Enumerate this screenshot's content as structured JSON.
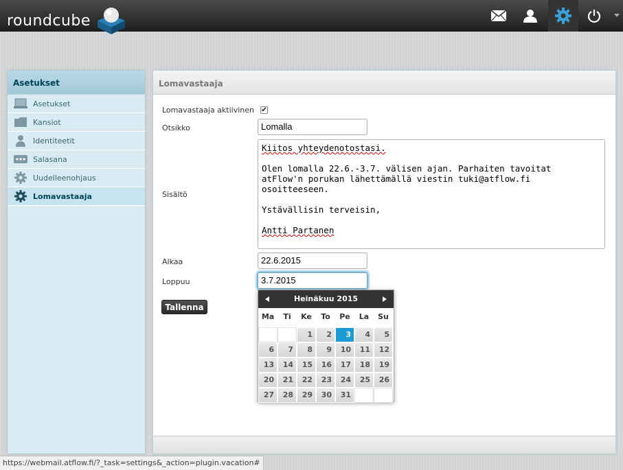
{
  "app": {
    "name": "roundcube"
  },
  "topbar": {
    "buttons": [
      "mail-icon",
      "contacts-icon",
      "settings-icon",
      "logout-icon"
    ],
    "active": "settings-icon",
    "accent": "#3ca0d8"
  },
  "sidebar": {
    "title": "Asetukset",
    "items": [
      {
        "label": "Asetukset",
        "icon": "monitor-icon"
      },
      {
        "label": "Kansiot",
        "icon": "folder-icon"
      },
      {
        "label": "Identiteetit",
        "icon": "person-icon"
      },
      {
        "label": "Salasana",
        "icon": "password-icon"
      },
      {
        "label": "Uudelleenohjaus",
        "icon": "gear-icon"
      },
      {
        "label": "Lomavastaaja",
        "icon": "gear-icon",
        "selected": true
      }
    ]
  },
  "main": {
    "title": "Lomavastaaja",
    "form": {
      "active_label": "Lomavastaaja aktiivinen",
      "active_checked": true,
      "subject_label": "Otsikko",
      "subject_value": "Lomalla",
      "body_label": "Sisältö",
      "body_lines": [
        "Kiitos yhteydenotostasi.",
        "",
        "Olen lomalla 22.6.-3.7. välisen ajan. Parhaiten tavoitat",
        "atFlow'n porukan lähettämällä viestin tuki@atflow.fi",
        "osoitteeseen.",
        "",
        "Ystävällisin terveisin,",
        "",
        "Antti Partanen"
      ],
      "start_label": "Alkaa",
      "start_value": "22.6.2015",
      "end_label": "Loppuu",
      "end_value": "3.7.2015",
      "save_label": "Tallenna"
    }
  },
  "datepicker": {
    "month_label": "Heinäkuu 2015",
    "weekdays": [
      "Ma",
      "Ti",
      "Ke",
      "To",
      "Pe",
      "La",
      "Su"
    ],
    "weeks": [
      [
        "",
        "",
        "1",
        "2",
        "3",
        "4",
        "5"
      ],
      [
        "6",
        "7",
        "8",
        "9",
        "10",
        "11",
        "12"
      ],
      [
        "13",
        "14",
        "15",
        "16",
        "17",
        "18",
        "19"
      ],
      [
        "20",
        "21",
        "22",
        "23",
        "24",
        "25",
        "26"
      ],
      [
        "27",
        "28",
        "29",
        "30",
        "31",
        "",
        ""
      ]
    ],
    "selected_day": "3",
    "selected_color": "#1a9bd4"
  },
  "statusbar": {
    "url": "https://webmail.atflow.fi/?_task=settings&_action=plugin.vacation#"
  }
}
